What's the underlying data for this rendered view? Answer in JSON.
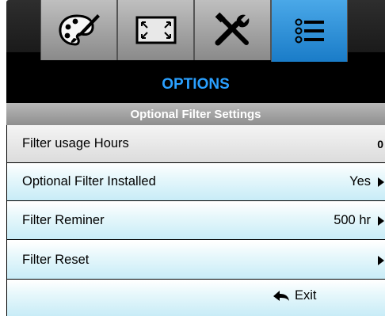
{
  "tabs": [
    {
      "icon": "palette-icon",
      "active": false
    },
    {
      "icon": "screen-resize-icon",
      "active": false
    },
    {
      "icon": "tools-icon",
      "active": false
    },
    {
      "icon": "list-menu-icon",
      "active": true
    }
  ],
  "header": {
    "title": "OPTIONS",
    "subtitle": "Optional Filter Settings"
  },
  "rows": [
    {
      "label": "Filter usage Hours",
      "value": "0"
    },
    {
      "label": "Optional Filter Installed",
      "value": "Yes"
    },
    {
      "label": "Filter Reminer",
      "value": "500 hr"
    },
    {
      "label": "Filter Reset",
      "value": ""
    }
  ],
  "footer": {
    "exit_label": "Exit"
  },
  "colors": {
    "title_blue": "#2aa0ff",
    "active_tab": "#2a8ad8",
    "row_highlight": "#c8ecf7"
  }
}
